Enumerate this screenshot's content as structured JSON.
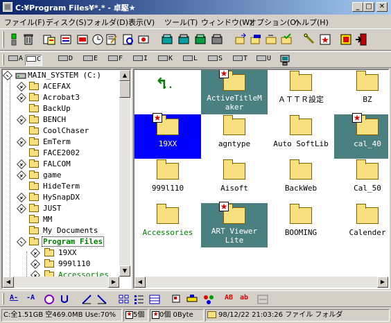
{
  "window": {
    "title": "C:¥Program Files¥*.* - 卓駆★",
    "minimize": "_",
    "maximize": "□",
    "close": "✕"
  },
  "menu": [
    "ファイル(F)",
    "ディスク(S)",
    "フォルダ(D)",
    "表示(V)",
    "ツール(T)",
    "ウィンドウ(W)",
    "オプション(O)",
    "ヘルプ(H)"
  ],
  "drives": [
    "A",
    "C",
    "D",
    "E",
    "F",
    "I",
    "K",
    "L",
    "S",
    "T",
    "U"
  ],
  "active_drive": "C",
  "tree": {
    "root": "MAIN_SYSTEM (C:)",
    "items": [
      "ACEFAX",
      "Acrobat3",
      "BackUp",
      "BENCH",
      "CoolChaser",
      "EmTerm",
      "FACE2002",
      "FALCOM",
      "game",
      "HideTerm",
      "HySnapDX",
      "JUST",
      "MM",
      "My Documents",
      "Program Files"
    ],
    "selected": "Program Files",
    "children": [
      "19XX",
      "999l110",
      "Accessories"
    ]
  },
  "files": [
    {
      "name": "..",
      "type": "up"
    },
    {
      "name": "ActiveTitleMaker",
      "star": true,
      "sel": "teal",
      "line1": "ActiveTitleM",
      "line2": "aker"
    },
    {
      "name": "ＡＴＴＲ設定"
    },
    {
      "name": "BZ"
    },
    {
      "name": "19XX",
      "star": true,
      "sel": "blue"
    },
    {
      "name": "agntype"
    },
    {
      "name": "Auto SoftLib"
    },
    {
      "name": "cal_40",
      "star": true,
      "sel": "teal"
    },
    {
      "name": "999l110"
    },
    {
      "name": "Aisoft"
    },
    {
      "name": "BackWeb"
    },
    {
      "name": "Cal_50"
    },
    {
      "name": "Accessories",
      "green": true
    },
    {
      "name": "ART Viewer Lite",
      "star": true,
      "sel": "teal",
      "line1": "ART Viewer",
      "line2": "Lite"
    },
    {
      "name": "BOOMING"
    },
    {
      "name": "Calender"
    }
  ],
  "bottom_toolbar": [
    "A-",
    "-A",
    "AB",
    "ab"
  ],
  "status": {
    "disk": "C:全1.51GB 空469.0MB Use:70%",
    "marked_count": "5個",
    "selected_count": "0個 0Byte",
    "date": "98/12/22 21:03:26",
    "type": "ファイル フォルダ"
  },
  "colors": {
    "selection_blue": "#0000ff",
    "marked_teal": "#4a8080",
    "title_start": "#0a246a",
    "title_end": "#a6caf0"
  }
}
